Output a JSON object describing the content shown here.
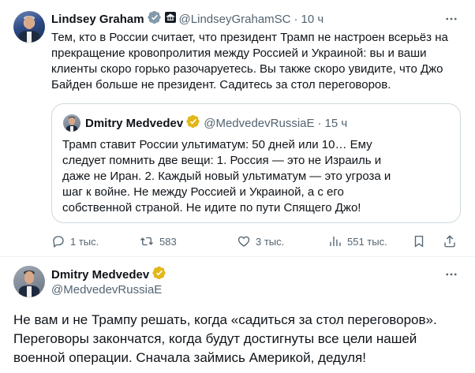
{
  "post": {
    "author_name": "Lindsey Graham",
    "author_handle": "@LindseyGrahamSC",
    "time": "10 ч",
    "text": "Тем, кто в России считает, что президент Трамп не настроен всерьёз на прекращение кровопролития между Россией и Украиной: вы и ваши клиенты скоро горько разочаруетесь. Вы также скоро увидите, что Джо Байден больше не президент. Садитесь за стол переговоров.",
    "menu_icon": "more-icon",
    "quote": {
      "author_name": "Dmitry Medvedev",
      "author_handle": "@MedvedevRussiaE",
      "time": "15 ч",
      "text": "Трамп ставит России ультиматум: 50 дней или 10… Ему следует помнить две вещи: 1. Россия — это не Израиль и даже не Иран. 2. Каждый новый ультиматум — это угроза и шаг к войне. Не между Россией и Украиной, а с его собственной страной. Не идите по пути Спящего Джо!"
    },
    "actions": {
      "replies": "1 тыс.",
      "reposts": "583",
      "likes": "3 тыс.",
      "views": "551 тыс."
    }
  },
  "reply": {
    "author_name": "Dmitry Medvedev",
    "author_handle": "@MedvedevRussiaE",
    "text": "Не вам и не Трампу решать, когда «садиться за стол переговоров». Переговоры закончатся, когда будут достигнуты все цели нашей военной операции. Сначала займись Америкой, дедуля!",
    "menu_icon": "more-icon"
  },
  "colors": {
    "verified_gold": "#e2b719",
    "verified_gray": "#829aab",
    "accent": "#1d9bf0",
    "muted": "#536471"
  }
}
